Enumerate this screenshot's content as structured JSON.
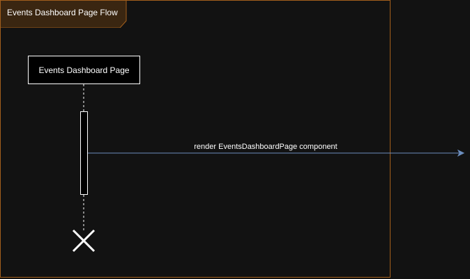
{
  "frame": {
    "title": "Events Dashboard Page Flow",
    "border_color": "#a35f1c",
    "label_fill": "#3a2611"
  },
  "participant": {
    "label": "Events Dashboard Page"
  },
  "message": {
    "label": "render EventsDashboardPage component",
    "color": "#6c8ebf"
  },
  "lifeline": {
    "end_marker": "destroy-x-icon"
  }
}
